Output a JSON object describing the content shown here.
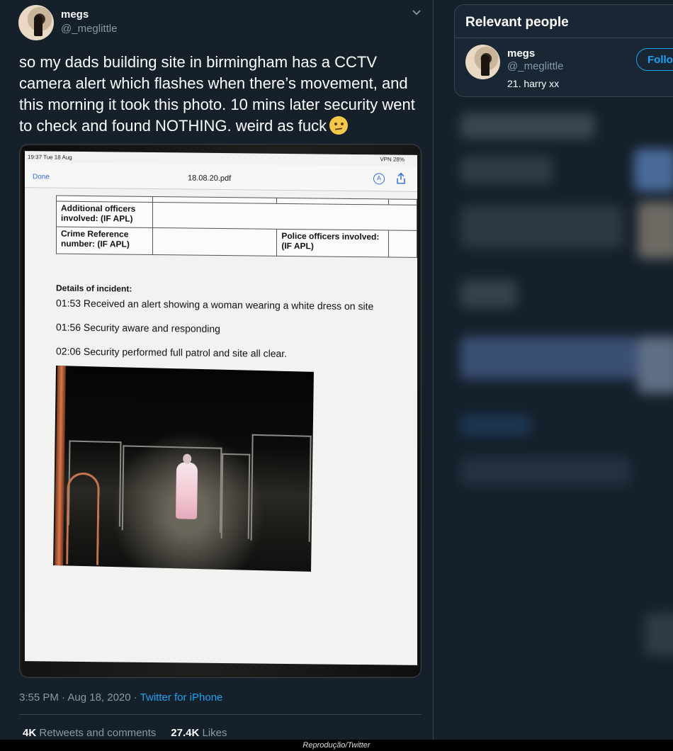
{
  "tweet": {
    "author_name": "megs",
    "author_handle": "@_meglittle",
    "text": "so my dads building site in birmingham has a CCTV camera alert which flashes when there’s movement, and this morning it took this photo. 10 mins later security went to check and found NOTHING. weird as fuck",
    "emoji": "confused-face",
    "timestamp": "3:55 PM · Aug 18, 2020 · ",
    "source": "Twitter for iPhone",
    "retweets_count": "4K",
    "retweets_label": "Retweets and comments",
    "likes_count": "27.4K",
    "likes_label": "Likes"
  },
  "photo": {
    "status_time": "19:37  Tue 18 Aug",
    "status_right": "VPN 28%",
    "nav_done": "Done",
    "nav_title": "18.08.20.pdf",
    "form": {
      "additional_officers": "Additional officers involved: (IF APL)",
      "crime_reference": "Crime Reference number: (IF APL)",
      "police_officers": "Police officers involved: (IF APL)"
    },
    "details_heading": "Details of incident:",
    "details": [
      "01:53 Received an alert showing a woman wearing a white dress on site",
      "01:56 Security aware and responding",
      "02:06 Security performed full patrol and site all clear."
    ]
  },
  "sidebar": {
    "title": "Relevant people",
    "person": {
      "name": "megs",
      "handle": "@_meglittle",
      "bio": "21. harry xx",
      "follow_label": "Follow"
    }
  },
  "credit": "Reprodução/Twitter",
  "colors": {
    "background": "#15202b",
    "accent": "#1da1f2",
    "muted": "#8899a6",
    "border": "#38444d"
  }
}
